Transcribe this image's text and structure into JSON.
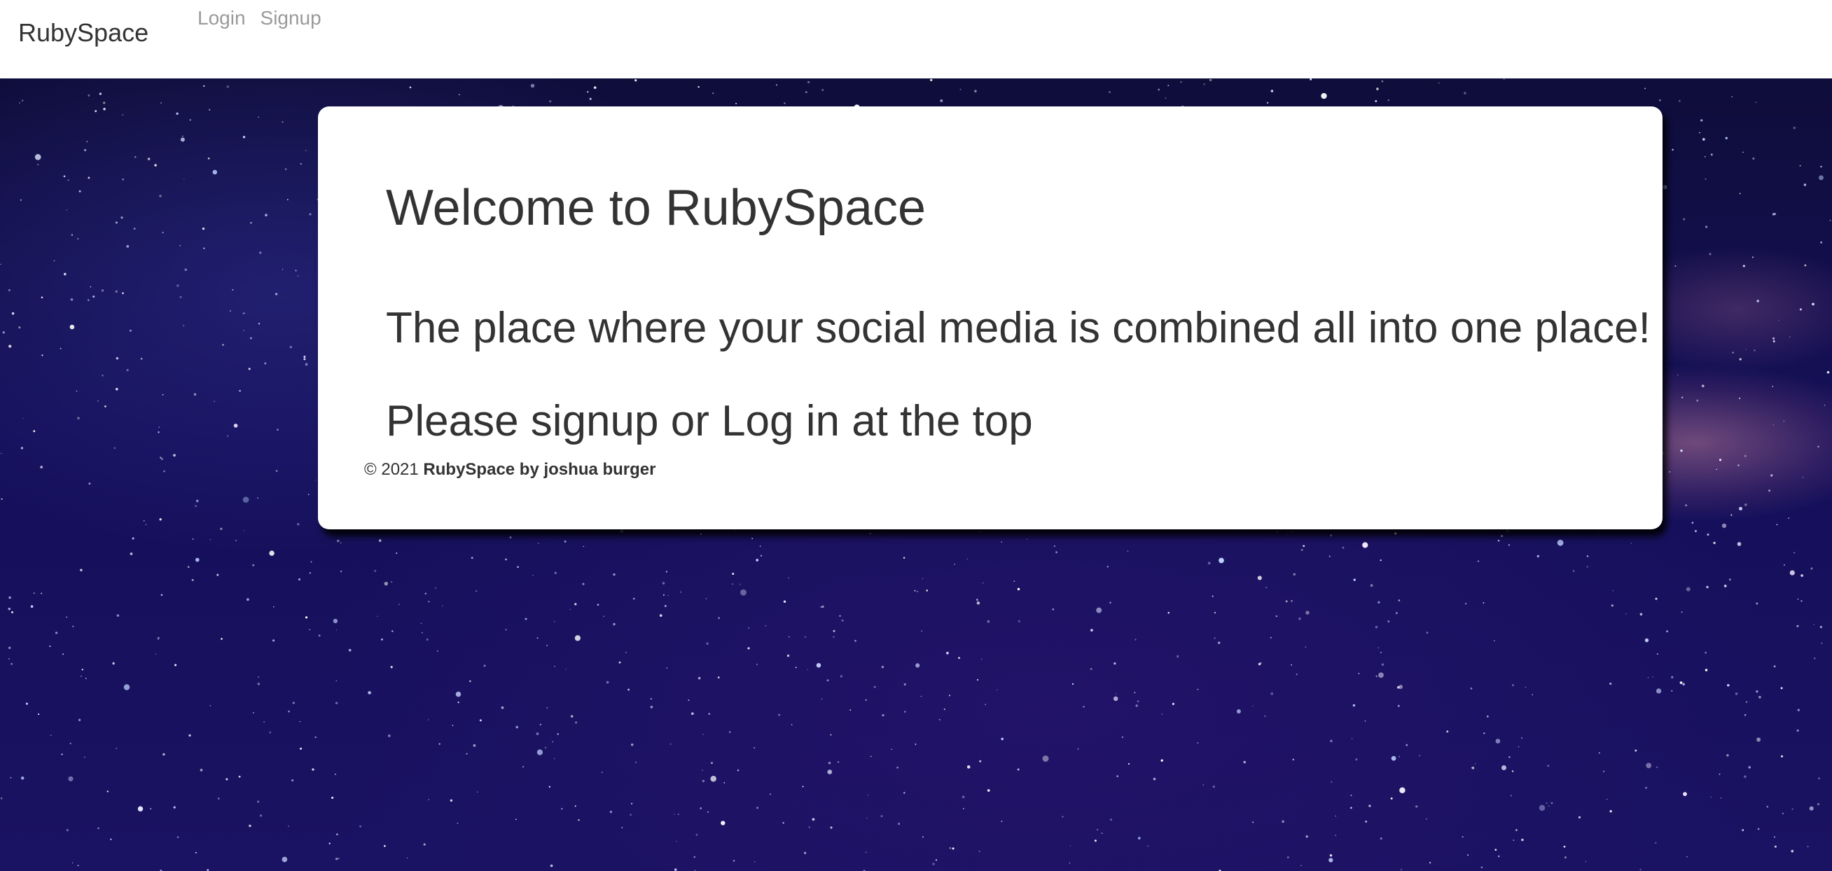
{
  "navbar": {
    "brand": "RubySpace",
    "links": [
      {
        "label": "Login"
      },
      {
        "label": "Signup"
      }
    ]
  },
  "hero": {
    "title": "Welcome to RubySpace",
    "tagline": "The place where your social media is combined all into one place!",
    "instruction": "Please signup or Log in at the top"
  },
  "footer": {
    "copyright": "© 2021",
    "credit": "RubySpace by joshua burger"
  },
  "colors": {
    "navbar_bg": "#ffffff",
    "text": "#333333",
    "nav_link": "#9a9a9a",
    "sky": "#15105a"
  }
}
